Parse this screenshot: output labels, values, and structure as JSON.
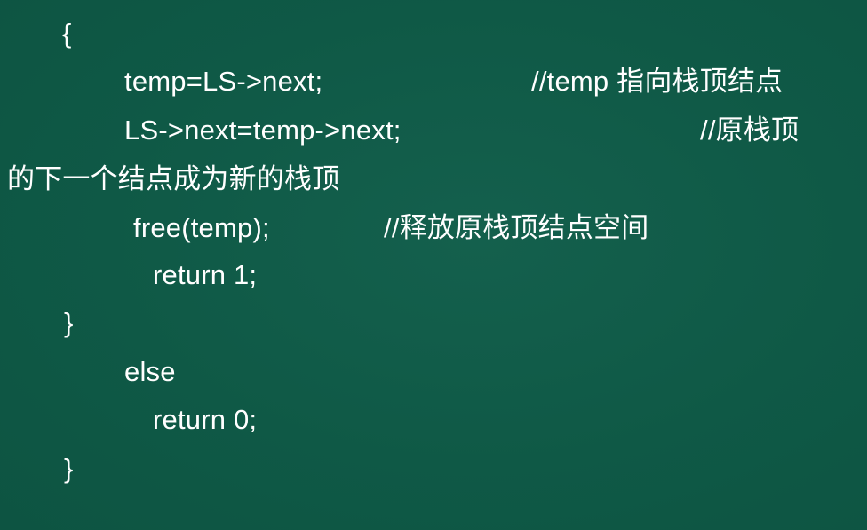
{
  "code": {
    "open_brace": "{",
    "line_temp_assign": "temp=LS->next;",
    "comment_temp": "//temp 指向栈顶结点",
    "line_next_assign": "LS->next=temp->next;",
    "comment_orig_top": "//原栈顶",
    "comment_wrap": "的下一个结点成为新的栈顶",
    "line_free": "free(temp);",
    "comment_free": "//释放原栈顶结点空间",
    "line_return_1": "return 1;",
    "close_brace_inner": "}",
    "line_else": "else",
    "line_return_0": "return 0;",
    "close_brace_outer": "}"
  }
}
